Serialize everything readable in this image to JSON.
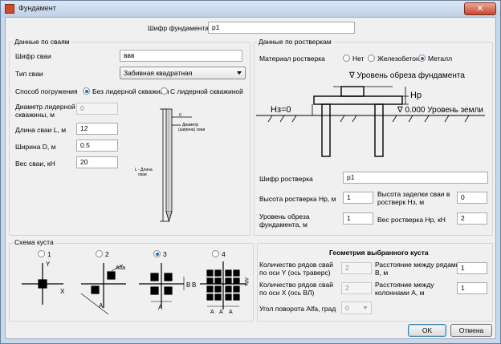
{
  "window": {
    "title": "Фундамент",
    "close_glyph": "✕"
  },
  "header": {
    "code_label": "Шифр фундамента",
    "code_value": "p1"
  },
  "piles": {
    "title": "Данные по сваям",
    "code_label": "Шифр сваи",
    "code_value": "ввв",
    "type_label": "Тип сваи",
    "type_value": "Забивная квадратная",
    "method_label": "Способ погружения",
    "method_opt1": "Без лидерной скважины",
    "method_opt2": "С лидерной скважиной",
    "leader_diam_label_1": "Диаметр лидерной",
    "leader_diam_label_2": "скважины, м",
    "leader_diam_value": "0",
    "length_label": "Длина сваи L, м",
    "length_value": "12",
    "width_label": "Ширина D, м",
    "width_value": "0.5",
    "weight_label": "Вес сваи, кН",
    "weight_value": "20"
  },
  "pile_diagram": {
    "top_value": "0",
    "diam_label_1": "Диаметр",
    "diam_label_2": "(ширина) сваи",
    "length_label_1": "L - Длина",
    "length_label_2": "сваи"
  },
  "grillage": {
    "title": "Данные по ростверкам",
    "material_label": "Материал ростверка",
    "mat_opt1": "Нет",
    "mat_opt2": "Железобетон",
    "mat_opt3": "Металл",
    "code_label": "Шифр ростверка",
    "code_value": "p1",
    "height_label": "Высота ростверка Нр, м",
    "height_value": "1",
    "embed_label_1": "Высота заделки сваи в",
    "embed_label_2": "ростверк Нз, м",
    "embed_value": "0",
    "cut_label_1": "Уровень обреза",
    "cut_label_2": "фундамента, м",
    "cut_value": "1",
    "weight_label": "Вес ростверка Нр, кН",
    "weight_value": "2"
  },
  "grillage_diagram": {
    "cut_level": "∇ Уровень обреза фундамента",
    "hp": "Нр",
    "hz": "Нз=0",
    "ground_level": "∇ 0.000 Уровень земли"
  },
  "cluster": {
    "title": "Схема куста",
    "options": [
      "1",
      "2",
      "3",
      "4"
    ],
    "selected": "3",
    "labels": {
      "y": "Y",
      "x": "X",
      "alfa": "Alfa",
      "a": "A",
      "b": "B"
    }
  },
  "geometry": {
    "title": "Геометрия выбранного куста",
    "rows_y_label_1": "Количество рядов свай",
    "rows_y_label_2": "по оси Y (ось траверс)",
    "rows_y_value": "2",
    "rows_x_label_1": "Количество рядов свай",
    "rows_x_label_2": "по оси X (ось ВЛ)",
    "rows_x_value": "2",
    "dist_b_label_1": "Расстояние между рядами",
    "dist_b_label_2": "В, м",
    "dist_b_value": "1",
    "dist_a_label_1": "Расстояние между",
    "dist_a_label_2": "колоннами А, м",
    "dist_a_value": "1",
    "angle_label": "Угол поворота Alfa, град",
    "angle_value": "0"
  },
  "buttons": {
    "ok": "OK",
    "cancel": "Отмена"
  }
}
